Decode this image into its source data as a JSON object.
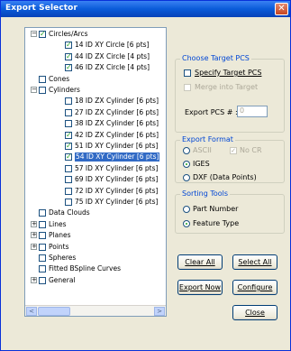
{
  "window": {
    "title": "Export Selector",
    "close_glyph": "✕"
  },
  "tree": {
    "items": [
      {
        "label": "Circles/Arcs",
        "expander": "−",
        "checked": true
      },
      {
        "label": "14 ID XY Circle [6 pts]",
        "checked": true
      },
      {
        "label": "44 ID ZX Circle [4 pts]",
        "checked": true
      },
      {
        "label": "46 ID ZX Circle [4 pts]",
        "checked": true
      },
      {
        "label": "Cones",
        "checked": false
      },
      {
        "label": "Cylinders",
        "expander": "−",
        "checked": false
      },
      {
        "label": "18 ID ZX Cylinder [6 pts]",
        "checked": false
      },
      {
        "label": "27 ID ZX Cylinder [6 pts]",
        "checked": false
      },
      {
        "label": "38 ID ZX Cylinder [6 pts]",
        "checked": false
      },
      {
        "label": "42 ID ZX Cylinder [6 pts]",
        "checked": true
      },
      {
        "label": "51 ID XY Cylinder [6 pts]",
        "checked": true
      },
      {
        "label": "54 ID XY Cylinder [6 pts]",
        "checked": true,
        "selected": true
      },
      {
        "label": "57 ID XY Cylinder [6 pts]",
        "checked": false
      },
      {
        "label": "69 ID XY Cylinder [6 pts]",
        "checked": false
      },
      {
        "label": "72 ID XY Cylinder [6 pts]",
        "checked": false
      },
      {
        "label": "75 ID XY Cylinder [6 pts]",
        "checked": false
      },
      {
        "label": "Data Clouds",
        "checked": false
      },
      {
        "label": "Lines",
        "expander": "+",
        "checked": false
      },
      {
        "label": "Planes",
        "expander": "+",
        "checked": false
      },
      {
        "label": "Points",
        "expander": "+",
        "checked": false
      },
      {
        "label": "Spheres",
        "checked": false
      },
      {
        "label": "Fitted BSpline Curves",
        "checked": false
      },
      {
        "label": "General",
        "expander": "+",
        "checked": false
      }
    ],
    "scroll_left": "<",
    "scroll_right": ">"
  },
  "target_pcs": {
    "title": "Choose Target PCS",
    "specify_label": "Specify Target PCS",
    "merge_label": "Merge into Target",
    "export_pcs_label": "Export PCS # :",
    "export_pcs_value": "0"
  },
  "export_format": {
    "title": "Export Format",
    "ascii": "ASCII",
    "no_cr": "No CR",
    "iges": "IGES",
    "dxf": "DXF (Data Points)"
  },
  "sorting": {
    "title": "Sorting Tools",
    "part_number": "Part Number",
    "feature_type": "Feature Type"
  },
  "buttons": {
    "clear_all": "Clear All",
    "select_all": "Select All",
    "export_now": "Export Now",
    "configure": "Configure",
    "close": "Close"
  },
  "colors": {
    "title_bar": "#0a5bd9",
    "group_title": "#0046d5",
    "selection": "#316ac5",
    "check": "#21a121"
  }
}
